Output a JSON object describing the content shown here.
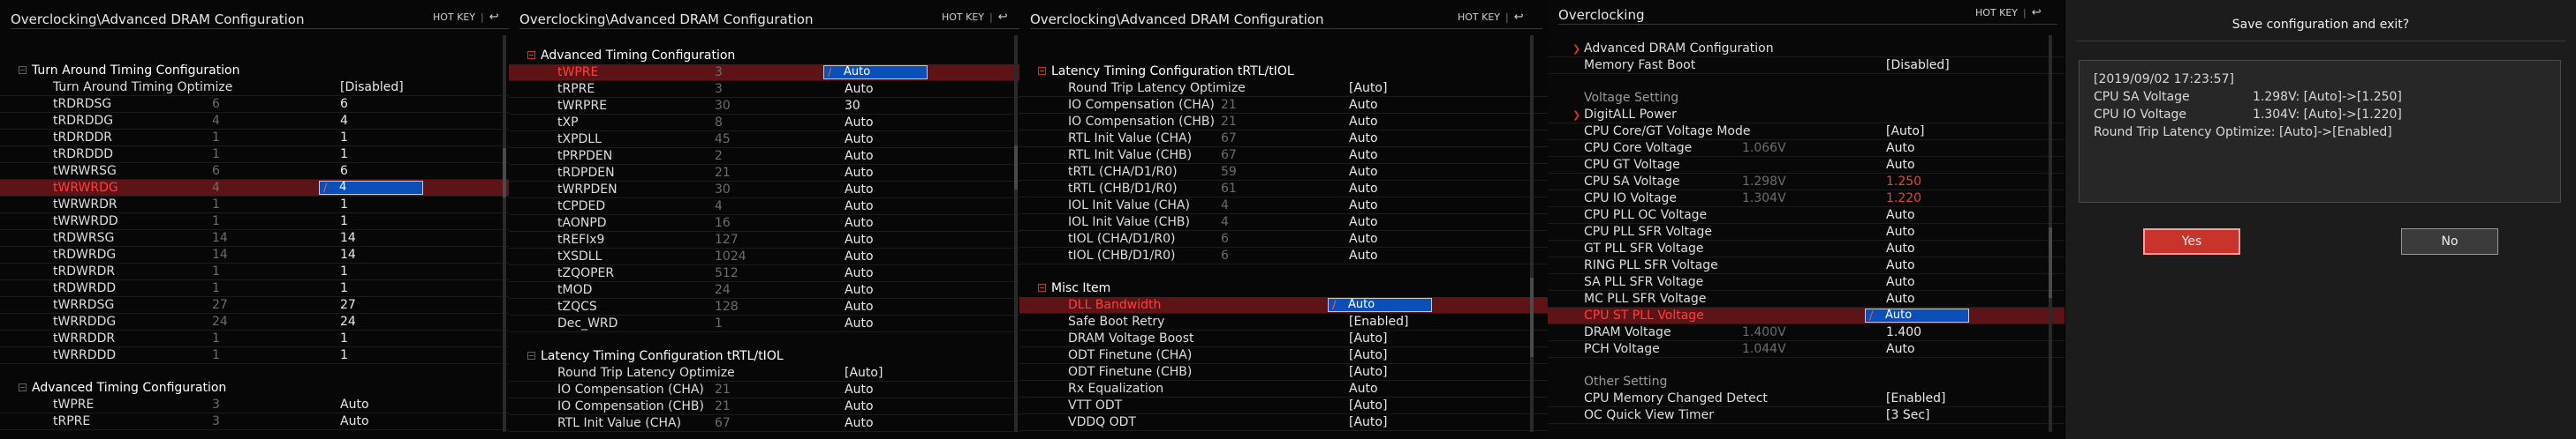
{
  "hotkey": "HOT KEY",
  "separator": "|",
  "back_glyph": "↩",
  "p1": {
    "title": "Overclocking\\Advanced DRAM Configuration",
    "sections": [
      {
        "title": "Turn Around Timing Configuration",
        "rows": [
          {
            "label": "Turn Around Timing Optimize",
            "cur": "",
            "val": "[Disabled]"
          },
          {
            "label": "tRDRDSG",
            "cur": "6",
            "val": "6"
          },
          {
            "label": "tRDRDDG",
            "cur": "4",
            "val": "4"
          },
          {
            "label": "tRDRDDR",
            "cur": "1",
            "val": "1"
          },
          {
            "label": "tRDRDDD",
            "cur": "1",
            "val": "1"
          },
          {
            "label": "tWRWRSG",
            "cur": "6",
            "val": "6"
          },
          {
            "label": "tWRWRDG",
            "cur": "4",
            "val": "4",
            "selected": true
          },
          {
            "label": "tWRWRDR",
            "cur": "1",
            "val": "1"
          },
          {
            "label": "tWRWRDD",
            "cur": "1",
            "val": "1"
          },
          {
            "label": "tRDWRSG",
            "cur": "14",
            "val": "14"
          },
          {
            "label": "tRDWRDG",
            "cur": "14",
            "val": "14"
          },
          {
            "label": "tRDWRDR",
            "cur": "1",
            "val": "1"
          },
          {
            "label": "tRDWRDD",
            "cur": "1",
            "val": "1"
          },
          {
            "label": "tWRRDSG",
            "cur": "27",
            "val": "27"
          },
          {
            "label": "tWRRDDG",
            "cur": "24",
            "val": "24"
          },
          {
            "label": "tWRRDDR",
            "cur": "1",
            "val": "1"
          },
          {
            "label": "tWRRDDD",
            "cur": "1",
            "val": "1"
          }
        ]
      },
      {
        "title": "Advanced Timing Configuration",
        "rows": [
          {
            "label": "tWPRE",
            "cur": "3",
            "val": "Auto"
          },
          {
            "label": "tRPRE",
            "cur": "3",
            "val": "Auto"
          }
        ]
      }
    ]
  },
  "p2": {
    "title": "Overclocking\\Advanced DRAM Configuration",
    "sections": [
      {
        "title": "Advanced Timing Configuration",
        "rows": [
          {
            "label": "tWPRE",
            "cur": "3",
            "val": "Auto",
            "selected": true
          },
          {
            "label": "tRPRE",
            "cur": "3",
            "val": "Auto"
          },
          {
            "label": "tWRPRE",
            "cur": "30",
            "val": "30"
          },
          {
            "label": "tXP",
            "cur": "8",
            "val": "Auto"
          },
          {
            "label": "tXPDLL",
            "cur": "45",
            "val": "Auto"
          },
          {
            "label": "tPRPDEN",
            "cur": "2",
            "val": "Auto"
          },
          {
            "label": "tRDPDEN",
            "cur": "21",
            "val": "Auto"
          },
          {
            "label": "tWRPDEN",
            "cur": "30",
            "val": "Auto"
          },
          {
            "label": "tCPDED",
            "cur": "4",
            "val": "Auto"
          },
          {
            "label": "tAONPD",
            "cur": "16",
            "val": "Auto"
          },
          {
            "label": "tREFIx9",
            "cur": "127",
            "val": "Auto"
          },
          {
            "label": "tXSDLL",
            "cur": "1024",
            "val": "Auto"
          },
          {
            "label": "tZQOPER",
            "cur": "512",
            "val": "Auto"
          },
          {
            "label": "tMOD",
            "cur": "24",
            "val": "Auto"
          },
          {
            "label": "tZQCS",
            "cur": "128",
            "val": "Auto"
          },
          {
            "label": "Dec_WRD",
            "cur": "1",
            "val": "Auto"
          }
        ]
      },
      {
        "title": "Latency Timing Configuration tRTL/tIOL",
        "rows": [
          {
            "label": "Round Trip Latency Optimize",
            "cur": "",
            "val": "[Auto]"
          },
          {
            "label": "IO Compensation (CHA)",
            "cur": "21",
            "val": "Auto"
          },
          {
            "label": "IO Compensation (CHB)",
            "cur": "21",
            "val": "Auto"
          },
          {
            "label": "RTL Init Value (CHA)",
            "cur": "67",
            "val": "Auto"
          }
        ]
      }
    ]
  },
  "p3": {
    "title": "Overclocking\\Advanced DRAM Configuration",
    "sections": [
      {
        "title": "Latency Timing Configuration tRTL/tIOL",
        "rows": [
          {
            "label": "Round Trip Latency Optimize",
            "cur": "",
            "val": "[Auto]"
          },
          {
            "label": "IO Compensation (CHA)",
            "cur": "21",
            "val": "Auto"
          },
          {
            "label": "IO Compensation (CHB)",
            "cur": "21",
            "val": "Auto"
          },
          {
            "label": "RTL Init Value (CHA)",
            "cur": "67",
            "val": "Auto"
          },
          {
            "label": "RTL Init Value (CHB)",
            "cur": "67",
            "val": "Auto"
          },
          {
            "label": "tRTL (CHA/D1/R0)",
            "cur": "59",
            "val": "Auto"
          },
          {
            "label": "tRTL (CHB/D1/R0)",
            "cur": "61",
            "val": "Auto"
          },
          {
            "label": "IOL Init Value (CHA)",
            "cur": "4",
            "val": "Auto"
          },
          {
            "label": "IOL Init Value (CHB)",
            "cur": "4",
            "val": "Auto"
          },
          {
            "label": "tIOL (CHA/D1/R0)",
            "cur": "6",
            "val": "Auto"
          },
          {
            "label": "tIOL (CHB/D1/R0)",
            "cur": "6",
            "val": "Auto"
          }
        ]
      },
      {
        "title": "Misc Item",
        "rows": [
          {
            "label": "DLL Bandwidth",
            "cur": "",
            "val": "Auto",
            "selected": true
          },
          {
            "label": "Safe Boot Retry",
            "cur": "",
            "val": "[Enabled]"
          },
          {
            "label": "DRAM Voltage Boost",
            "cur": "",
            "val": "[Auto]"
          },
          {
            "label": "ODT Finetune (CHA)",
            "cur": "",
            "val": "[Auto]"
          },
          {
            "label": "ODT Finetune (CHB)",
            "cur": "",
            "val": "[Auto]"
          },
          {
            "label": "Rx Equalization",
            "cur": "",
            "val": "Auto"
          },
          {
            "label": "VTT ODT",
            "cur": "",
            "val": "[Auto]"
          },
          {
            "label": "VDDQ ODT",
            "cur": "",
            "val": "[Auto]"
          }
        ]
      }
    ]
  },
  "p4": {
    "title": "Overclocking",
    "rows_top": [
      {
        "label": "Advanced DRAM Configuration",
        "cur": "",
        "val": "",
        "sub": true
      },
      {
        "label": "Memory Fast Boot",
        "cur": "",
        "val": "[Disabled]"
      }
    ],
    "voltage_header": "Voltage Setting",
    "rows_voltage": [
      {
        "label": "DigitALL Power",
        "cur": "",
        "val": "",
        "sub": true
      },
      {
        "label": "CPU Core/GT Voltage Mode",
        "cur": "",
        "val": "[Auto]"
      },
      {
        "label": "CPU Core Voltage",
        "cur": "1.066V",
        "val": "Auto"
      },
      {
        "label": "CPU GT Voltage",
        "cur": "",
        "val": "Auto"
      },
      {
        "label": "CPU SA Voltage",
        "cur": "1.298V",
        "val": "1.250",
        "red": true
      },
      {
        "label": "CPU IO Voltage",
        "cur": "1.304V",
        "val": "1.220",
        "red": true
      },
      {
        "label": "CPU PLL OC Voltage",
        "cur": "",
        "val": "Auto"
      },
      {
        "label": "CPU PLL SFR Voltage",
        "cur": "",
        "val": "Auto"
      },
      {
        "label": "GT PLL SFR Voltage",
        "cur": "",
        "val": "Auto"
      },
      {
        "label": "RING PLL SFR Voltage",
        "cur": "",
        "val": "Auto"
      },
      {
        "label": "SA PLL SFR Voltage",
        "cur": "",
        "val": "Auto"
      },
      {
        "label": "MC PLL SFR Voltage",
        "cur": "",
        "val": "Auto"
      },
      {
        "label": "CPU ST PLL Voltage",
        "cur": "",
        "val": "Auto",
        "selected": true
      },
      {
        "label": "DRAM Voltage",
        "cur": "1.400V",
        "val": "1.400"
      },
      {
        "label": "PCH Voltage",
        "cur": "1.044V",
        "val": "Auto"
      }
    ],
    "other_header": "Other Setting",
    "rows_other": [
      {
        "label": "CPU Memory Changed Detect",
        "cur": "",
        "val": "[Enabled]"
      },
      {
        "label": "OC Quick View Timer",
        "cur": "",
        "val": "[3 Sec]"
      }
    ]
  },
  "dialog": {
    "title": "Save configuration and exit?",
    "timestamp": "[2019/09/02 17:23:57]",
    "lines": [
      {
        "label": "CPU SA Voltage",
        "value": "1.298V: [Auto]->[1.250]"
      },
      {
        "label": "CPU IO Voltage",
        "value": "1.304V: [Auto]->[1.220]"
      },
      {
        "label": "Round Trip Latency Optimize: [Auto]->[Enabled]",
        "value": ""
      }
    ],
    "yes_label": "Yes",
    "no_label": "No"
  }
}
